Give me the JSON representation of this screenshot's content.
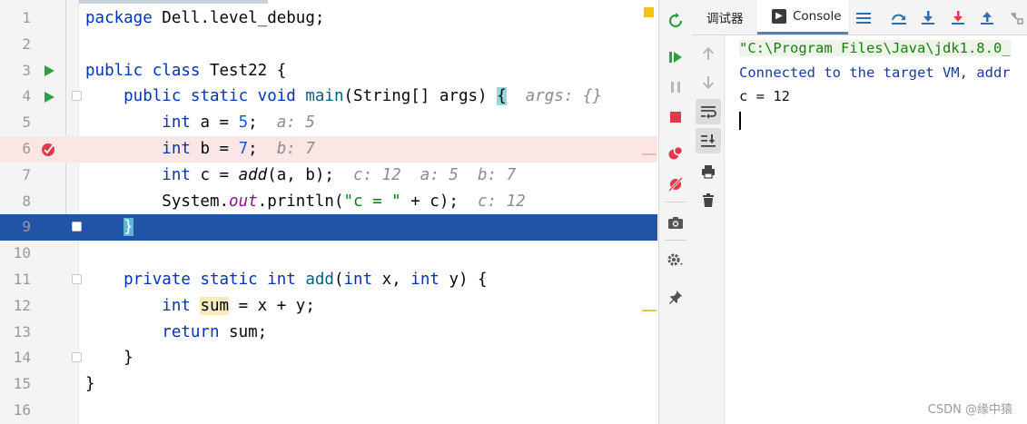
{
  "editor": {
    "lines": [
      {
        "n": "1",
        "tokens": [
          {
            "t": "package ",
            "c": "kw"
          },
          {
            "t": "Dell.level_debug;",
            "c": ""
          }
        ]
      },
      {
        "n": "2",
        "tokens": []
      },
      {
        "n": "3",
        "tokens": [
          {
            "t": "public ",
            "c": "kw"
          },
          {
            "t": "class ",
            "c": "kw"
          },
          {
            "t": "Test22 {",
            "c": ""
          }
        ],
        "icon": "run-icon"
      },
      {
        "n": "4",
        "tokens": [
          {
            "t": "    public ",
            "c": "kw"
          },
          {
            "t": "static ",
            "c": "kw"
          },
          {
            "t": "void ",
            "c": "kw"
          },
          {
            "t": "main",
            "c": "fn"
          },
          {
            "t": "(String[] args) ",
            "c": ""
          },
          {
            "t": "{",
            "c": "brace-hl"
          },
          {
            "t": "  args: {}",
            "c": "hint"
          }
        ],
        "icon": "run-icon",
        "fold": true
      },
      {
        "n": "5",
        "tokens": [
          {
            "t": "        int ",
            "c": "kw"
          },
          {
            "t": "a = ",
            "c": ""
          },
          {
            "t": "5",
            "c": "num"
          },
          {
            "t": ";  ",
            "c": ""
          },
          {
            "t": "a: 5",
            "c": "hint"
          }
        ]
      },
      {
        "n": "6",
        "tokens": [
          {
            "t": "        int ",
            "c": "kw"
          },
          {
            "t": "b = ",
            "c": ""
          },
          {
            "t": "7",
            "c": "num"
          },
          {
            "t": ";  ",
            "c": ""
          },
          {
            "t": "b: 7",
            "c": "hint"
          }
        ],
        "icon": "breakpoint-icon",
        "state": "bp"
      },
      {
        "n": "7",
        "tokens": [
          {
            "t": "        int ",
            "c": "kw"
          },
          {
            "t": "c = ",
            "c": ""
          },
          {
            "t": "add",
            "c": "it"
          },
          {
            "t": "(a, b);  ",
            "c": ""
          },
          {
            "t": "c: 12  a: 5  b: 7",
            "c": "hint"
          }
        ]
      },
      {
        "n": "8",
        "tokens": [
          {
            "t": "        System.",
            "c": ""
          },
          {
            "t": "out",
            "c": "fld"
          },
          {
            "t": ".println(",
            "c": ""
          },
          {
            "t": "\"c = \"",
            "c": "str"
          },
          {
            "t": " + c);  ",
            "c": ""
          },
          {
            "t": "c: 12",
            "c": "hint"
          }
        ]
      },
      {
        "n": "9",
        "tokens": [
          {
            "t": "    ",
            "c": ""
          },
          {
            "t": "}",
            "c": "brace-hl"
          }
        ],
        "state": "exec",
        "fold": true
      },
      {
        "n": "10",
        "tokens": []
      },
      {
        "n": "11",
        "tokens": [
          {
            "t": "    private ",
            "c": "kw"
          },
          {
            "t": "static ",
            "c": "kw"
          },
          {
            "t": "int ",
            "c": "kw"
          },
          {
            "t": "add",
            "c": "fn"
          },
          {
            "t": "(",
            "c": ""
          },
          {
            "t": "int ",
            "c": "kw"
          },
          {
            "t": "x, ",
            "c": ""
          },
          {
            "t": "int ",
            "c": "kw"
          },
          {
            "t": "y) {",
            "c": ""
          }
        ],
        "fold": true
      },
      {
        "n": "12",
        "tokens": [
          {
            "t": "        int ",
            "c": "kw"
          },
          {
            "t": "sum",
            "c": "var-hl"
          },
          {
            "t": " = x + y;",
            "c": ""
          }
        ]
      },
      {
        "n": "13",
        "tokens": [
          {
            "t": "        return ",
            "c": "kw"
          },
          {
            "t": "sum;",
            "c": ""
          }
        ]
      },
      {
        "n": "14",
        "tokens": [
          {
            "t": "    }",
            "c": ""
          }
        ],
        "fold": true
      },
      {
        "n": "15",
        "tokens": [
          {
            "t": "}",
            "c": ""
          }
        ]
      },
      {
        "n": "16",
        "tokens": []
      }
    ]
  },
  "debug_panel": {
    "tabs": [
      {
        "label": "调试器",
        "active": false
      },
      {
        "label": "Console",
        "active": true
      }
    ],
    "console_lines": [
      {
        "text": "\"C:\\Program Files\\Java\\jdk1.8.0_",
        "kind": "c-cmd"
      },
      {
        "text": "Connected to the target VM, addr",
        "kind": "c-info"
      },
      {
        "text": "c = 12",
        "kind": "c-out"
      }
    ]
  },
  "watermark": "CSDN @缘中猿",
  "colors": {
    "keyword": "#0033b3",
    "number": "#1750eb",
    "string": "#067d17",
    "exec_line": "#2154a6",
    "breakpoint_line": "#fae7e5",
    "breakpoint": "#db3b4b",
    "run": "#2f9e44"
  }
}
